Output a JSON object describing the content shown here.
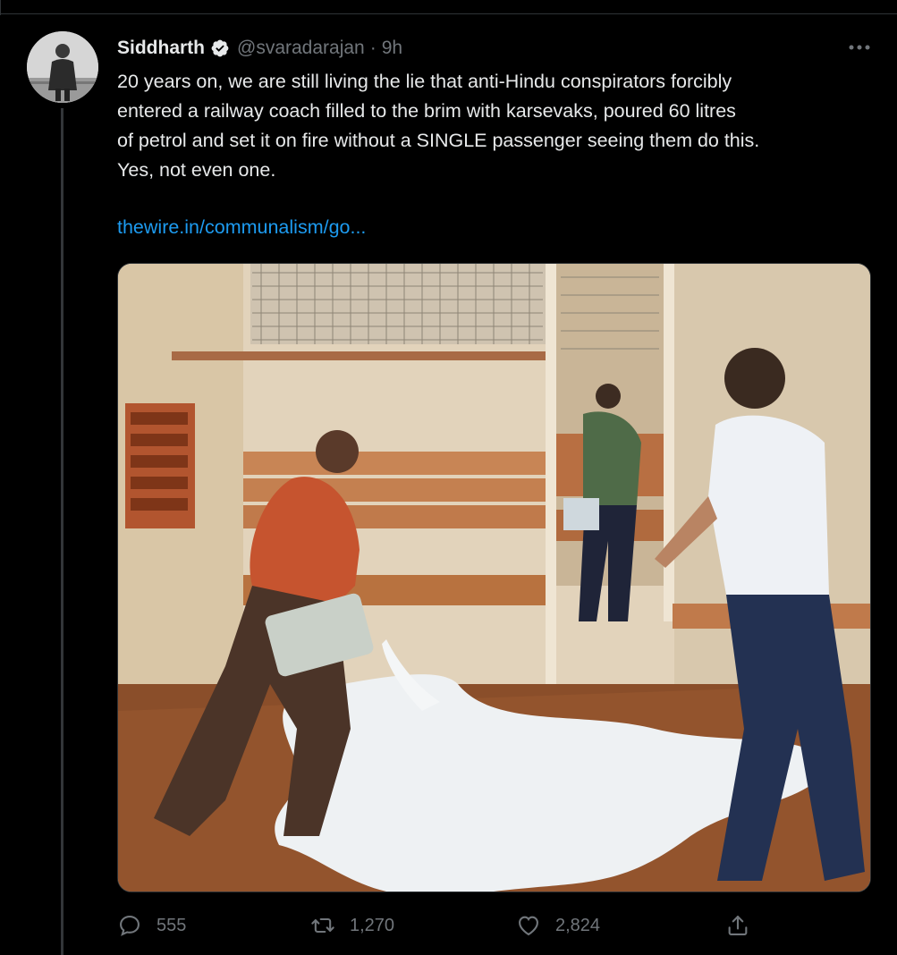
{
  "tweet": {
    "author": {
      "display_name": "Siddharth",
      "handle": "@svaradarajan",
      "separator": "·",
      "time": "9h"
    },
    "text_lines": [
      "20 years on, we are still living the lie that anti-Hindu conspirators forcibly",
      "entered a railway coach filled to the brim with karsevaks, poured 60 litres",
      "of petrol and set it on fire without a SINGLE passenger seeing them do this.",
      "Yes, not even one."
    ],
    "link": "thewire.in/communalism/go...",
    "stats": {
      "replies": "555",
      "retweets": "1,270",
      "likes": "2,824"
    }
  },
  "colors": {
    "background": "#000000",
    "text": "#e7e9ea",
    "secondary": "#71767b",
    "link": "#1d9bf0",
    "border": "#2f3336"
  },
  "icons": [
    "verified-badge-icon",
    "more-options-icon",
    "reply-icon",
    "retweet-icon",
    "like-icon",
    "share-icon"
  ]
}
